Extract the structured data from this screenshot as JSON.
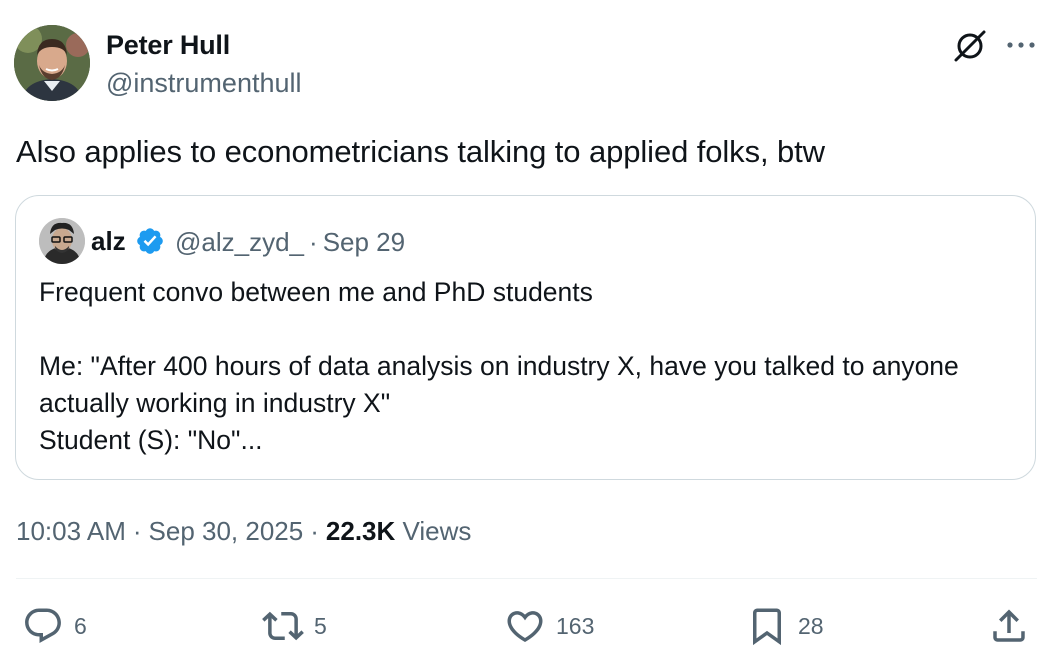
{
  "author": {
    "name": "Peter Hull",
    "handle": "@instrumenthull"
  },
  "tweet": {
    "text": "Also applies to econometricians talking to applied folks, btw"
  },
  "quoted": {
    "name": "alz",
    "handle": "@alz_zyd_",
    "separator": "·",
    "date": "Sep 29",
    "lines": [
      "Frequent convo between me and PhD students",
      "",
      "Me: \"After 400 hours of data analysis on industry X, have you talked to anyone",
      "actually working in industry X\"",
      "Student (S): \"No\"..."
    ]
  },
  "meta": {
    "time": "10:03 AM",
    "separator": "·",
    "date": "Sep 30, 2025",
    "views_count": "22.3K",
    "views_label": "Views"
  },
  "actions": {
    "replies": "6",
    "reposts": "5",
    "likes": "163",
    "bookmarks": "28"
  },
  "colors": {
    "text": "#0f1419",
    "secondary": "#536471",
    "border": "#cfd9de",
    "verified": "#1d9bf0"
  },
  "icons": [
    "grok-icon",
    "more-icon",
    "verified-badge-icon",
    "reply-icon",
    "repost-icon",
    "like-icon",
    "bookmark-icon",
    "share-icon"
  ]
}
